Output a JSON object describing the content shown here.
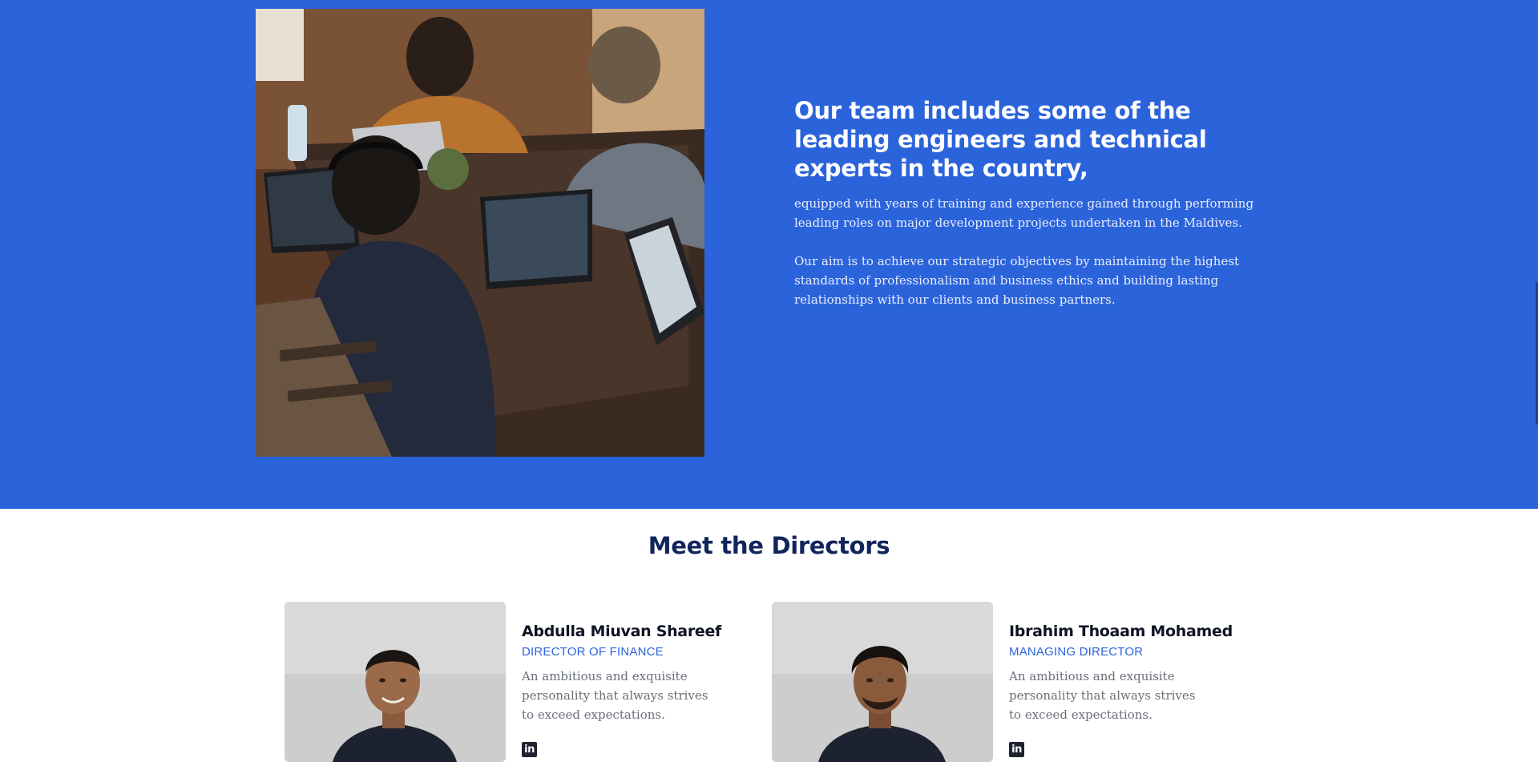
{
  "team": {
    "image_alt": "team-working-on-laptops",
    "heading": "Our team includes some of the leading engineers and technical experts in the country,",
    "paragraph1": "equipped with years of training and experience gained through performing leading roles on major development projects undertaken in the Maldives.",
    "paragraph2": "Our aim is to achieve our strategic objectives by maintaining the highest standards of professionalism and business ethics and building lasting relationships with our clients and business partners."
  },
  "directors": {
    "title": "Meet the Directors",
    "items": [
      {
        "name": "Abdulla Miuvan Shareef",
        "role": "DIRECTOR OF FINANCE",
        "bio": "An ambitious and exquisite personality that always strives to exceed expectations.",
        "social_icon": "linkedin-icon",
        "social_label": "in"
      },
      {
        "name": "Ibrahim Thoaam Mohamed",
        "role": "MANAGING DIRECTOR",
        "bio": "An ambitious and exquisite personality that always strives to exceed expectations.",
        "social_icon": "linkedin-icon",
        "social_label": "in"
      }
    ]
  },
  "colors": {
    "brand_blue": "#2b63db",
    "heading_navy": "#11245c",
    "text_dark": "#0f1424",
    "text_muted": "#6a6f7a"
  }
}
